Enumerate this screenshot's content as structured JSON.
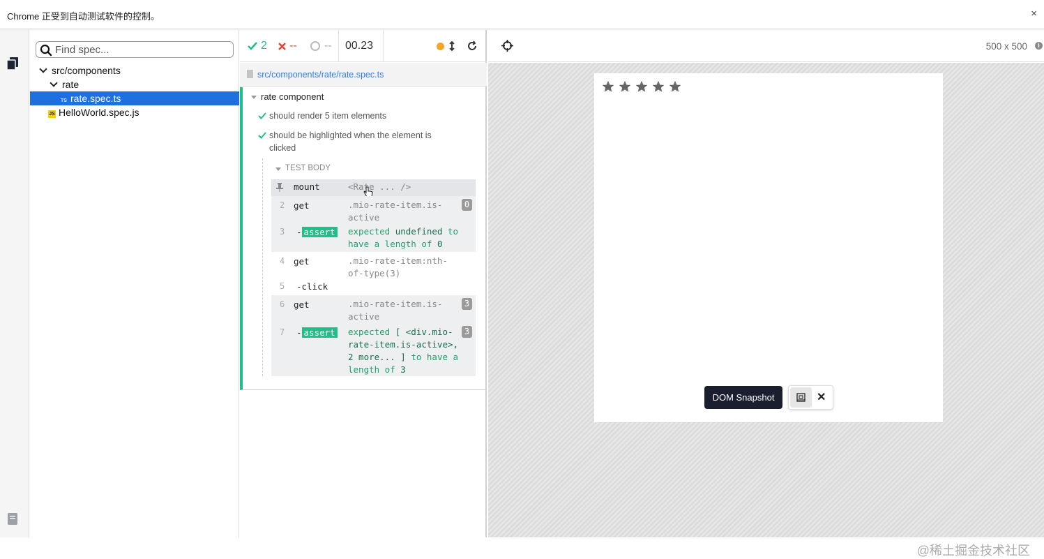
{
  "infobar": {
    "message": "Chrome 正受到自动测试软件的控制。",
    "close": "×"
  },
  "specs": {
    "search_placeholder": "Find spec...",
    "tree": [
      {
        "label": "src/components",
        "level": 0,
        "type": "folder"
      },
      {
        "label": "rate",
        "level": 1,
        "type": "folder"
      },
      {
        "label": "rate.spec.ts",
        "level": 2,
        "type": "ts",
        "badge": "TS",
        "selected": true
      },
      {
        "label": "HelloWorld.spec.js",
        "level": 1,
        "type": "js",
        "badge": "JS"
      }
    ]
  },
  "reporter": {
    "passed": "2",
    "failed": "--",
    "pending": "--",
    "duration": "00.23",
    "file": "src/components/rate/rate.spec.ts",
    "suite_title": "rate component",
    "tests": [
      "should render 5 item elements",
      "should be highlighted when the element is clicked"
    ],
    "test_body_label": "TEST BODY",
    "commands": [
      {
        "num": "",
        "name": "mount",
        "message": "<Rate ... />"
      },
      {
        "num": "2",
        "name": "get",
        "message": ".mio-rate-item.is-active",
        "badge": "0"
      },
      {
        "num": "3",
        "name": "-",
        "tag": "assert",
        "message_parts": [
          "expected ",
          "undefined",
          " to have a length of ",
          "0"
        ]
      },
      {
        "num": "4",
        "name": "get",
        "message": ".mio-rate-item:nth-of-type(3)"
      },
      {
        "num": "5",
        "name": "-click",
        "message": ""
      },
      {
        "num": "6",
        "name": "get",
        "message": ".mio-rate-item.is-active",
        "badge": "3"
      },
      {
        "num": "7",
        "name": "-",
        "tag": "assert",
        "message_parts": [
          "expected ",
          "[ <div.mio-rate-item.is-active>, 2 more... ]",
          " to have a length of ",
          "3"
        ],
        "badge": "3"
      }
    ]
  },
  "aut": {
    "viewport": "500 x 500",
    "info": "i",
    "stars": 5,
    "snapshot_label": "DOM Snapshot",
    "snapshot_close": "✕"
  },
  "watermark": "@稀土掘金技术社区",
  "colors": {
    "pass": "#1fbf87",
    "fail": "#e34234",
    "selected": "#1e6fe0",
    "link": "#3a7bd5",
    "running": "#f5a623"
  },
  "icons": [
    "copy-icon",
    "search-icon",
    "caret-down-icon",
    "check-icon",
    "x-icon",
    "spinner-icon",
    "sort-icon",
    "reload-icon",
    "crosshair-icon",
    "pin-icon",
    "star-icon",
    "snapshot-pin-icon",
    "close-icon",
    "book-icon"
  ]
}
